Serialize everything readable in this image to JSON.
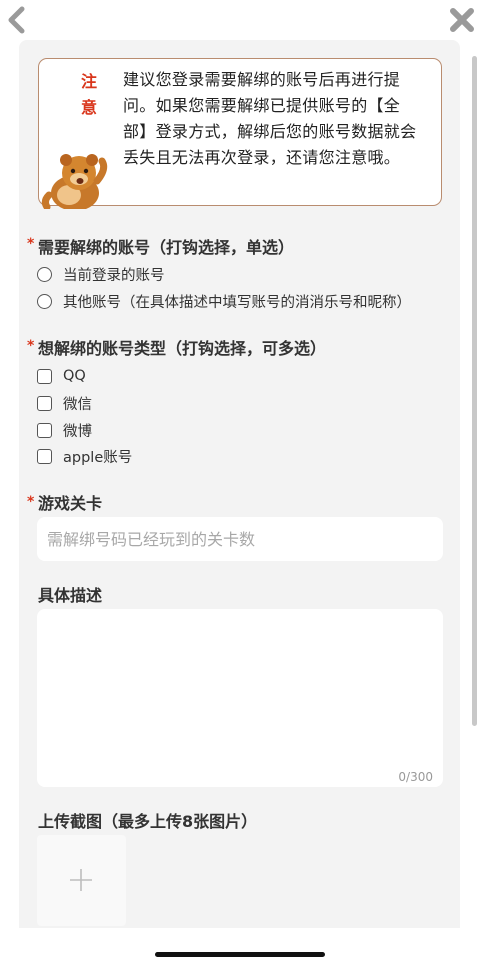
{
  "nav": {
    "back_icon": "chevron-left-icon",
    "close_icon": "close-icon"
  },
  "notice": {
    "tag_line1": "注",
    "tag_line2": "意",
    "text": "建议您登录需要解绑的账号后再进行提问。如果您需要解绑已提供账号的【全部】登录方式，解绑后您的账号数据就会丢失且无法再次登录，还请您注意哦。"
  },
  "required_mark": "*",
  "account_section": {
    "title": "需要解绑的账号（打钩选择，单选）",
    "options": [
      "当前登录的账号",
      "其他账号（在具体描述中填写账号的消消乐号和昵称）"
    ]
  },
  "type_section": {
    "title": "想解绑的账号类型（打钩选择，可多选）",
    "options": [
      "QQ",
      "微信",
      "微博",
      "apple账号"
    ]
  },
  "level_section": {
    "title": "游戏关卡",
    "placeholder": "需解绑号码已经玩到的关卡数"
  },
  "description_section": {
    "title": "具体描述",
    "counter": "0/300"
  },
  "upload_section": {
    "title": "上传截图（最多上传8张图片）",
    "icon": "plus-icon"
  }
}
